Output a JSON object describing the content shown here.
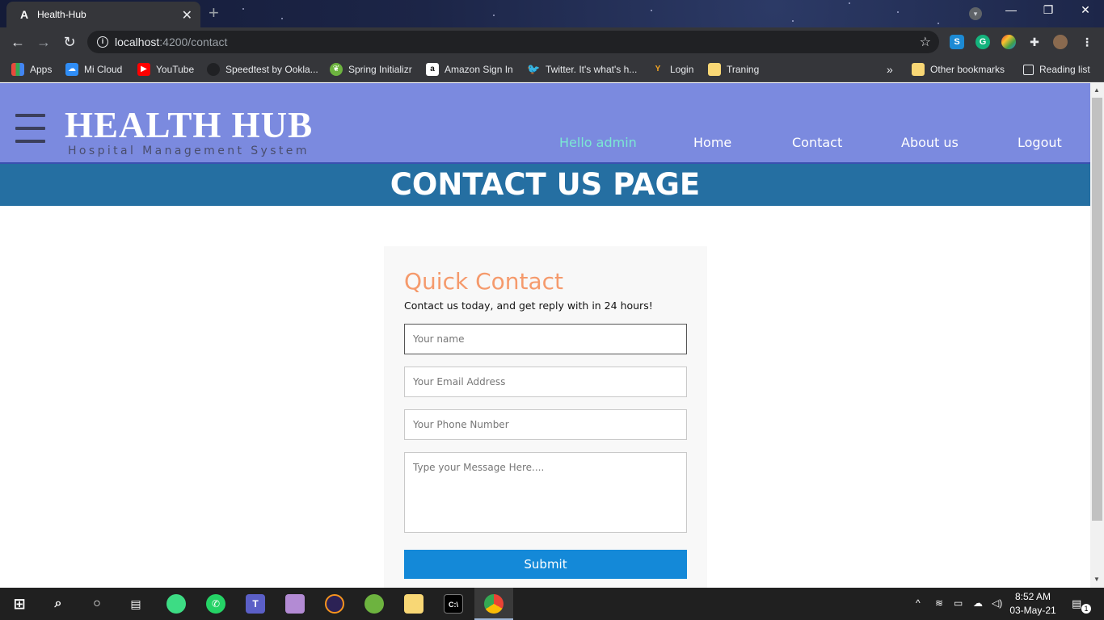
{
  "browser": {
    "tab_title": "Health-Hub",
    "tab_favicon": "A",
    "url_host": "localhost",
    "url_path": ":4200/contact",
    "bookmarks": [
      {
        "label": "Apps",
        "icon": "apps-grid-icon",
        "color": "#e84a3c"
      },
      {
        "label": "Mi Cloud",
        "icon": "mi-cloud-icon",
        "color": "#2f8df6"
      },
      {
        "label": "YouTube",
        "icon": "youtube-icon",
        "color": "#ff0000"
      },
      {
        "label": "Speedtest by Ookla...",
        "icon": "speedtest-icon",
        "color": "#202124"
      },
      {
        "label": "Spring Initializr",
        "icon": "spring-icon",
        "color": "#6db33f"
      },
      {
        "label": "Amazon Sign In",
        "icon": "amazon-icon",
        "color": "#ffffff"
      },
      {
        "label": "Twitter. It's what's h...",
        "icon": "twitter-icon",
        "color": "#1da1f2"
      },
      {
        "label": "Login",
        "icon": "login-icon",
        "color": "#f5a623"
      },
      {
        "label": "Traning",
        "icon": "folder-icon",
        "color": "#f8d775"
      }
    ],
    "other_bookmarks": "Other bookmarks",
    "reading_list": "Reading list",
    "more": "»"
  },
  "header": {
    "brand_title": "HEALTH HUB",
    "brand_subtitle": "Hospital Management System",
    "nav": {
      "hello": "Hello admin",
      "home": "Home",
      "contact": "Contact",
      "about": "About us",
      "logout": "Logout"
    }
  },
  "page_title": "CONTACT US PAGE",
  "contact_form": {
    "heading": "Quick Contact",
    "lead": "Contact us today, and get reply with in 24 hours!",
    "name_placeholder": "Your name",
    "email_placeholder": "Your Email Address",
    "phone_placeholder": "Your Phone Number",
    "message_placeholder": "Type your Message Here....",
    "submit_label": "Submit"
  },
  "taskbar": {
    "time": "8:52 AM",
    "date": "03-May-21",
    "notification_count": "1"
  }
}
